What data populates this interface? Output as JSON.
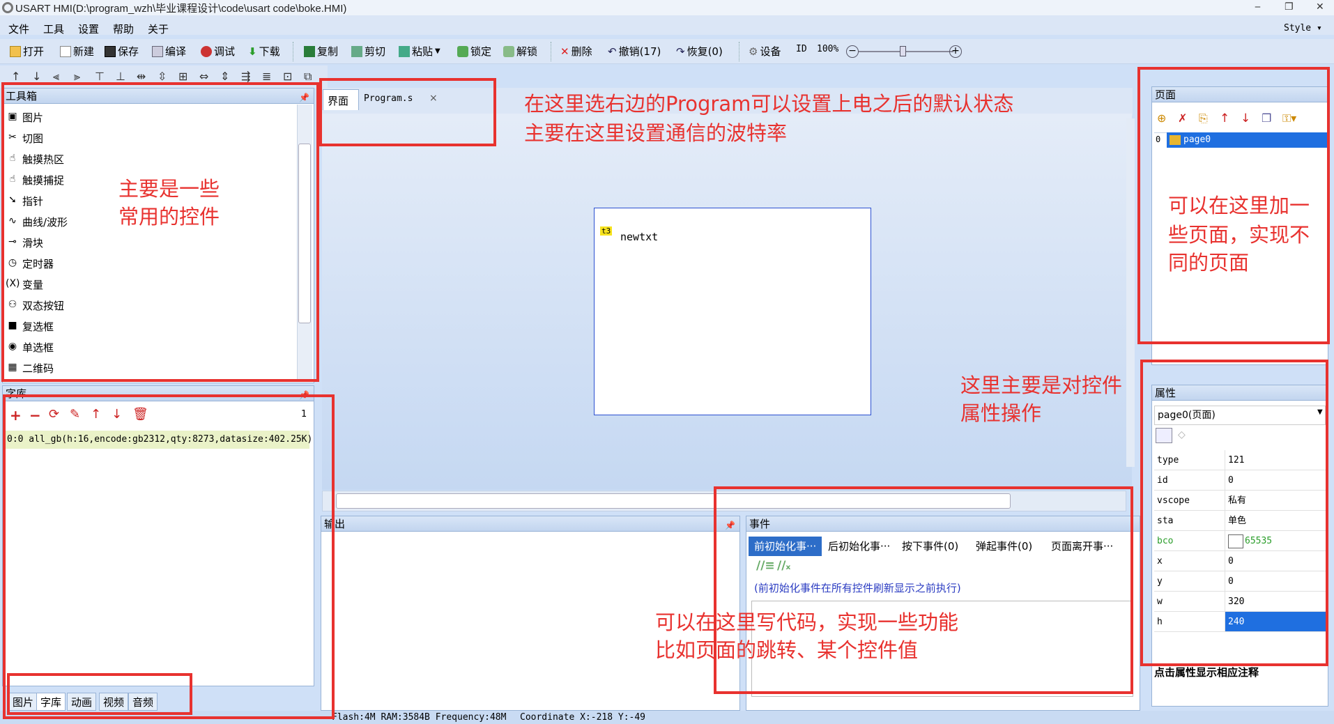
{
  "window": {
    "title": "USART  HMI(D:\\program_wzh\\毕业课程设计\\code\\usart code\\boke.HMI)",
    "style_label": "Style ▾"
  },
  "menu": [
    "文件",
    "工具",
    "设置",
    "帮助",
    "关于"
  ],
  "toolbar": {
    "open": "打开",
    "new": "新建",
    "save": "保存",
    "compile": "编译",
    "debug": "调试",
    "download": "下载",
    "copy": "复制",
    "cut": "剪切",
    "paste": "粘贴",
    "lock": "锁定",
    "unlock": "解锁",
    "delete": "删除",
    "undo": "撤销(17)",
    "redo": "恢复(0)",
    "settings": "设备",
    "id": "ID",
    "zoom": "100%"
  },
  "toolbox": {
    "title": "工具箱",
    "items": [
      "图片",
      "切图",
      "触摸热区",
      "触摸捕捉",
      "指针",
      "曲线/波形",
      "滑块",
      "定时器",
      "变量",
      "双态按钮",
      "复选框",
      "单选框",
      "二维码"
    ],
    "icons": [
      "image-icon",
      "scissors-icon",
      "touch-area-icon",
      "touch-capture-icon",
      "pointer-icon",
      "wave-icon",
      "slider-icon",
      "timer-icon",
      "variable-icon",
      "toggle-button-icon",
      "checkbox-icon",
      "radio-icon",
      "qrcode-icon"
    ]
  },
  "fontlib": {
    "title": "字库",
    "count": "1",
    "entry": "0:0   all_gb(h:16,encode:gb2312,qty:8273,datasize:402.25K)"
  },
  "bottom_tabs": [
    "图片",
    "字库",
    "动画",
    "视频",
    "音频"
  ],
  "editor": {
    "tabs": [
      "界面",
      "Program.s"
    ],
    "close": "×",
    "widget_id": "t3",
    "widget_text": "newtxt"
  },
  "output": {
    "title": "输出"
  },
  "events": {
    "title": "事件",
    "tabs": [
      "前初始化事···",
      "后初始化事···",
      "按下事件(0)",
      "弹起事件(0)",
      "页面离开事···"
    ],
    "hint": "(前初始化事件在所有控件刷新显示之前执行)"
  },
  "pages": {
    "title": "页面",
    "items": [
      {
        "index": "0",
        "name": "page0"
      }
    ]
  },
  "props": {
    "title": "属性",
    "selected": "page0(页面)",
    "rows": [
      {
        "k": "type",
        "v": "121"
      },
      {
        "k": "id",
        "v": "0"
      },
      {
        "k": "vscope",
        "v": "私有"
      },
      {
        "k": "sta",
        "v": "单色"
      },
      {
        "k": "bco",
        "v": "65535"
      },
      {
        "k": "x",
        "v": "0"
      },
      {
        "k": "y",
        "v": "0"
      },
      {
        "k": "w",
        "v": "320"
      },
      {
        "k": "h",
        "v": "240"
      }
    ],
    "note": "点击属性显示相应注释"
  },
  "status": {
    "text": "Flash:4M RAM:3584B Frequency:48M",
    "coord": "Coordinate X:-218  Y:-49"
  },
  "annotations": {
    "top1": "在这里选右边的Program可以设置上电之后的默认状态",
    "top2": "主要在这里设置通信的波特率",
    "left1": "主要是一些",
    "left2": "常用的控件",
    "right1": "可以在这里加一",
    "right2": "些页面，实现不",
    "right3": "同的页面",
    "mid1": "这里主要是对控件",
    "mid2": "属性操作",
    "code1": "可以在这里写代码，实现一些功能",
    "code2": "比如页面的跳转、某个控件值"
  },
  "colors": {
    "accent_red": "#e8322f",
    "selection_blue": "#1f6fe0",
    "bco_green": "#2a9d2a"
  }
}
